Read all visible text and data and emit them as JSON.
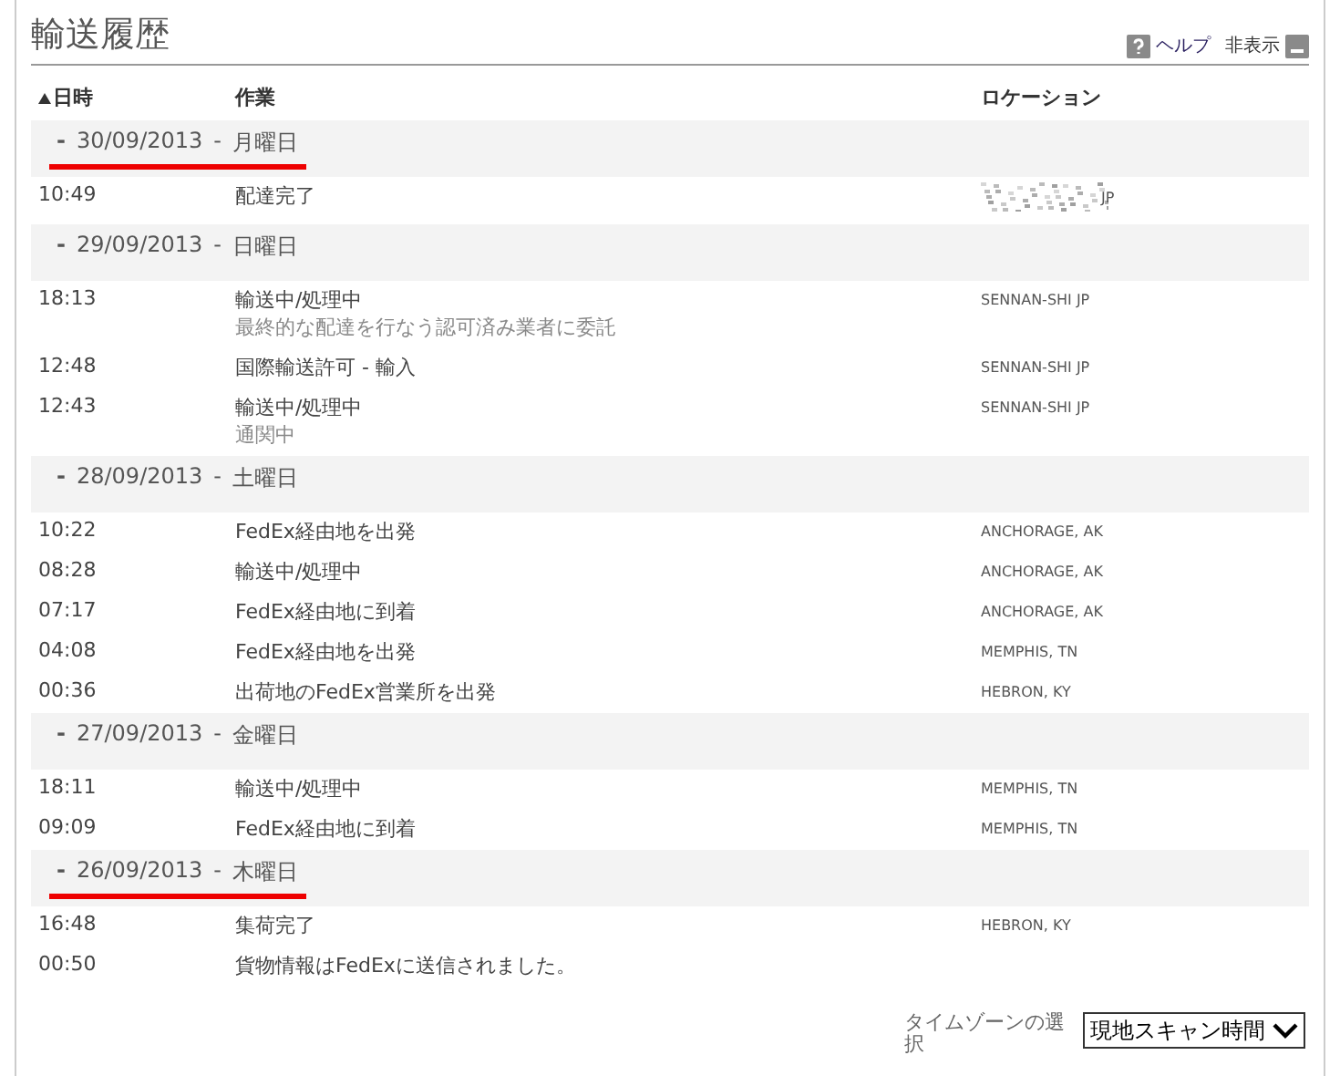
{
  "title": "輸送履歴",
  "header_links": [
    {
      "label": "ヘルプ",
      "kind": "help"
    },
    {
      "label": "非表示",
      "kind": "hide"
    }
  ],
  "columns": [
    {
      "label": "日時",
      "sorted": true
    },
    {
      "label": "作業",
      "sorted": false
    },
    {
      "label": "ロケーション",
      "sorted": false
    }
  ],
  "groups": [
    {
      "toggle": "-",
      "date": "30/09/2013",
      "separator": "-",
      "weekday": "月曜日",
      "underlined": true,
      "events": [
        {
          "time": "10:49",
          "activity": "配達完了",
          "location": "JP",
          "redacted": true
        }
      ]
    },
    {
      "toggle": "-",
      "date": "29/09/2013",
      "separator": "-",
      "weekday": "日曜日",
      "underlined": false,
      "events": [
        {
          "time": "18:13",
          "activity": "輸送中/処理中",
          "detail": "最終的な配達を行なう認可済み業者に委託",
          "location": "SENNAN-SHI JP",
          "redacted": false
        },
        {
          "time": "12:48",
          "activity": "国際輸送許可 - 輸入",
          "location": "SENNAN-SHI JP",
          "redacted": false
        },
        {
          "time": "12:43",
          "activity": "輸送中/処理中",
          "detail": "通関中",
          "location": "SENNAN-SHI JP",
          "redacted": false
        }
      ]
    },
    {
      "toggle": "-",
      "date": "28/09/2013",
      "separator": "-",
      "weekday": "土曜日",
      "underlined": false,
      "events": [
        {
          "time": "10:22",
          "activity": "FedEx経由地を出発",
          "location": "ANCHORAGE, AK",
          "redacted": false
        },
        {
          "time": "08:28",
          "activity": "輸送中/処理中",
          "location": "ANCHORAGE, AK",
          "redacted": false
        },
        {
          "time": "07:17",
          "activity": "FedEx経由地に到着",
          "location": "ANCHORAGE, AK",
          "redacted": false
        },
        {
          "time": "04:08",
          "activity": "FedEx経由地を出発",
          "location": "MEMPHIS, TN",
          "redacted": false
        },
        {
          "time": "00:36",
          "activity": "出荷地のFedEx営業所を出発",
          "location": "HEBRON, KY",
          "redacted": false
        }
      ]
    },
    {
      "toggle": "-",
      "date": "27/09/2013",
      "separator": "-",
      "weekday": "金曜日",
      "underlined": false,
      "events": [
        {
          "time": "18:11",
          "activity": "輸送中/処理中",
          "location": "MEMPHIS, TN",
          "redacted": false
        },
        {
          "time": "09:09",
          "activity": "FedEx経由地に到着",
          "location": "MEMPHIS, TN",
          "redacted": false
        }
      ]
    },
    {
      "toggle": "-",
      "date": "26/09/2013",
      "separator": "-",
      "weekday": "木曜日",
      "underlined": true,
      "events": [
        {
          "time": "16:48",
          "activity": "集荷完了",
          "location": "HEBRON, KY",
          "redacted": false
        },
        {
          "time": "00:50",
          "activity": "貨物情報はFedExに送信されました。",
          "redacted": false
        }
      ]
    }
  ],
  "timezone": {
    "label": "タイムゾーンの選択",
    "value": "現地スキャン時間"
  }
}
